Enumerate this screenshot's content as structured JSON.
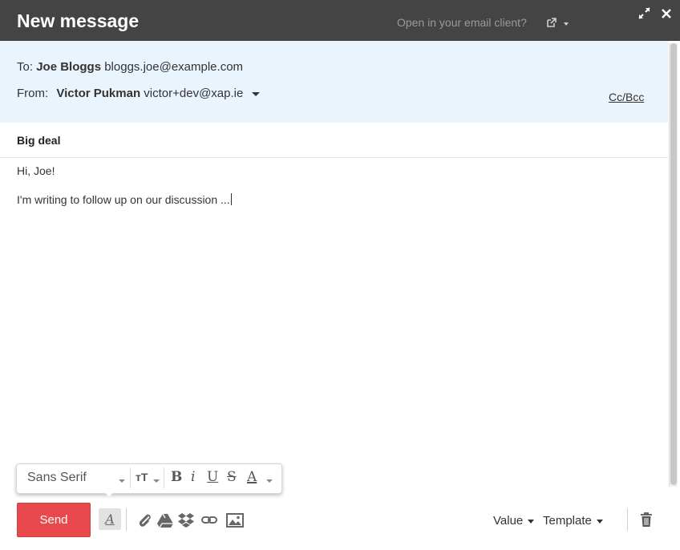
{
  "window": {
    "title": "New message",
    "open_in_client": "Open in your email client?",
    "icons": [
      "external-link-icon",
      "expand-icon",
      "close-icon"
    ]
  },
  "header": {
    "to_label": "To:",
    "to_name": "Joe Bloggs",
    "to_email": "bloggs.joe@example.com",
    "from_label": "From:",
    "from_name": "Victor Pukman",
    "from_email": "victor+dev@xap.ie",
    "cc_bcc": "Cc/Bcc"
  },
  "subject": "Big deal",
  "body": {
    "line1": "Hi, Joe!",
    "line2": "I'm writing to follow up on our discussion ..."
  },
  "formatting": {
    "font": "Sans Serif",
    "size_glyph": "ᴛT",
    "bold": "B",
    "italic": "i",
    "underline": "U",
    "strike": "S",
    "color": "A"
  },
  "footer": {
    "send_label": "Send",
    "format_toggle": "A",
    "value_label": "Value",
    "template_label": "Template",
    "tools": [
      "attachment-icon",
      "drive-icon",
      "dropbox-icon",
      "link-icon",
      "image-icon",
      "trash-icon"
    ]
  },
  "colors": {
    "titlebar": "#444444",
    "header_bg": "#eaf4fd",
    "send": "#e8494c"
  }
}
